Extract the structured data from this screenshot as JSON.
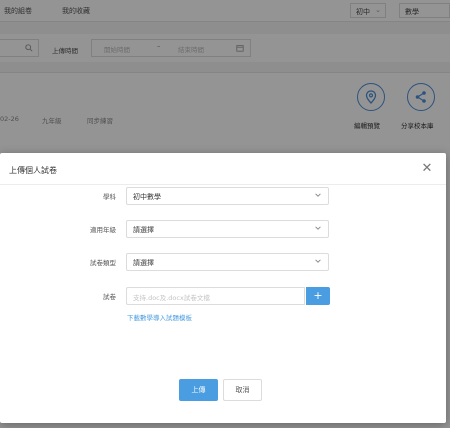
{
  "background": {
    "top_tabs": [
      "我的組卷",
      "我的收藏"
    ],
    "level_select": "初中",
    "subject_select": "數學",
    "filter": {
      "upload_time_label": "上傳時間",
      "start_placeholder": "開始時間",
      "end_placeholder": "結束時間"
    },
    "meta": {
      "date_fragment": "02-26",
      "grade": "九年級",
      "type": "同步練習"
    },
    "actions": {
      "edit_preview": "編輯預覽",
      "share_to_school": "分享校本庫"
    }
  },
  "modal": {
    "title": "上傳個人試卷",
    "close_symbol": "✕",
    "fields": {
      "subject_label": "學科",
      "subject_value": "初中數學",
      "grade_label": "適用年級",
      "grade_value": "請選擇",
      "paper_type_label": "試卷類型",
      "paper_type_value": "請選擇",
      "paper_label": "試卷",
      "paper_placeholder": "支持.doc及.docx試卷文檔",
      "add_symbol": "+",
      "template_link": "下載數學導入試題模板"
    },
    "buttons": {
      "upload": "上傳",
      "cancel": "取消"
    }
  },
  "colors": {
    "accent": "#4a9de0",
    "overlay": "rgba(0,0,0,0.42)"
  }
}
